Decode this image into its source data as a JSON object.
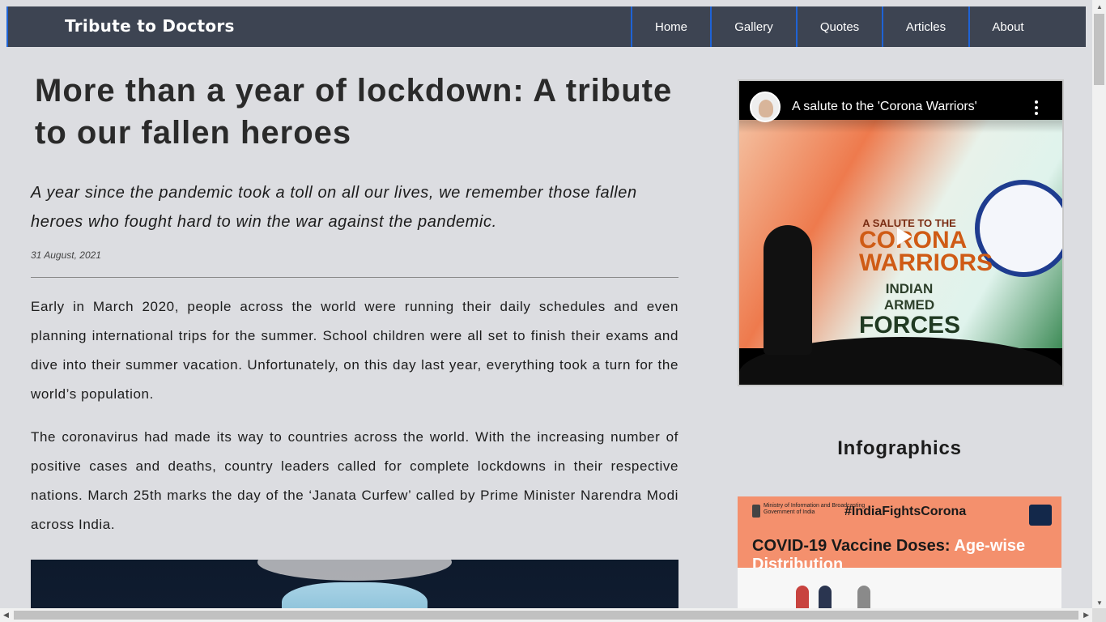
{
  "navbar": {
    "brand": "Tribute to Doctors",
    "links": [
      "Home",
      "Gallery",
      "Quotes",
      "Articles",
      "About"
    ]
  },
  "article": {
    "title": "More than a year of lockdown: A tribute to our fallen heroes",
    "subtitle": "A year since the pandemic took a toll on all our lives, we remember those fallen heroes who fought hard to win the war against the pandemic.",
    "date": "31 August, 2021",
    "paragraphs": [
      "Early in March 2020, people across the world were running their daily schedules and even planning international trips for the summer. School children were all set to finish their exams and dive into their summer vacation. Unfortunately, on this day last year, everything took a turn for the world’s population.",
      "The coronavirus had made its way to countries across the world. With the increasing number of positive cases and deaths, country leaders called for complete lockdowns in their respective nations. March 25th marks the day of the ‘Janata Curfew’ called by Prime Minister Narendra Modi across India."
    ]
  },
  "sidebar": {
    "video": {
      "title": "A salute to the 'Corona Warriors'",
      "thumbnail_text": {
        "line1": "A SALUTE TO THE",
        "line2": "CORONA",
        "line3": "WARRIORS",
        "line4": "INDIAN ARMED",
        "line5": "FORCES"
      }
    },
    "infographics_heading": "Infographics",
    "infographic": {
      "ministry": "Ministry of Information and Broadcasting",
      "ministry_sub": "Government of India",
      "hashtag": "#IndiaFightsCorona",
      "headline": "COVID-19 Vaccine Doses: ",
      "headline_accent": "Age-wise Distribution"
    }
  },
  "icons": {
    "play": "play-icon",
    "more": "more-vertical-icon",
    "scroll_up": "▲",
    "scroll_down": "▼",
    "scroll_left": "◀",
    "scroll_right": "▶"
  },
  "colors": {
    "navbar_bg": "#3d4452",
    "nav_divider": "#1e63d6",
    "page_bg": "#dcdde1",
    "infographic_accent": "#f4906d"
  }
}
